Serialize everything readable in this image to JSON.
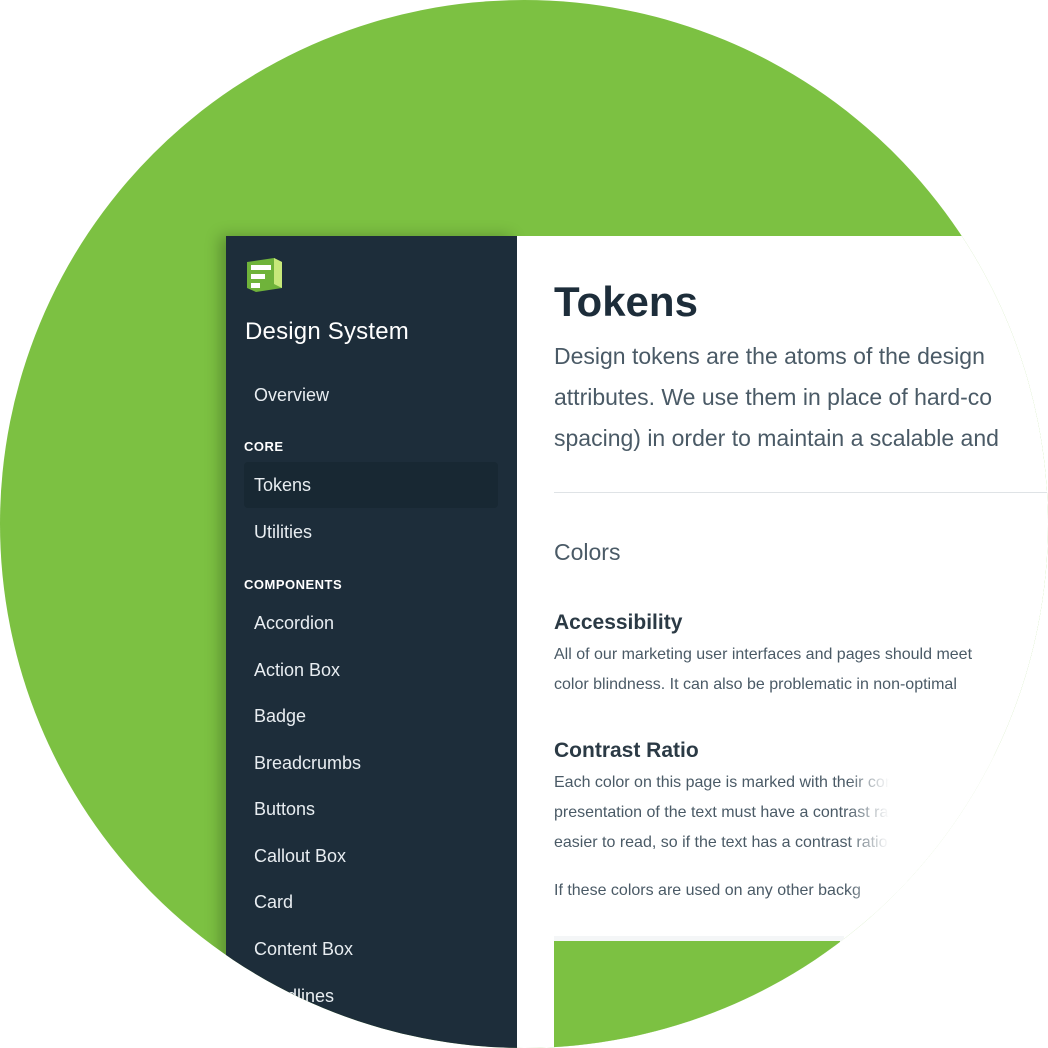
{
  "brand": {
    "name": "Design System"
  },
  "sidebar": {
    "items_top": [
      {
        "label": "Overview"
      }
    ],
    "sections": [
      {
        "label": "CORE",
        "items": [
          {
            "label": "Tokens",
            "active": true
          },
          {
            "label": "Utilities"
          }
        ]
      },
      {
        "label": "COMPONENTS",
        "items": [
          {
            "label": "Accordion"
          },
          {
            "label": "Action Box"
          },
          {
            "label": "Badge"
          },
          {
            "label": "Breadcrumbs"
          },
          {
            "label": "Buttons"
          },
          {
            "label": "Callout Box"
          },
          {
            "label": "Card"
          },
          {
            "label": "Content Box"
          },
          {
            "label": "Headlines"
          }
        ]
      }
    ]
  },
  "main": {
    "title": "Tokens",
    "intro_lines": [
      "Design tokens are the atoms of the design",
      "attributes. We use them in place of hard-co",
      "spacing) in order to maintain a scalable and"
    ],
    "colors_heading": "Colors",
    "accessibility": {
      "heading": "Accessibility",
      "lines": [
        "All of our marketing user interfaces and pages should meet",
        "color blindness. It can also be problematic in non-optimal"
      ]
    },
    "contrast": {
      "heading": "Contrast Ratio",
      "lines": [
        "Each color on this page is marked with their contrast",
        "presentation of the text must have a contrast ratio",
        "easier to read, so if the text has a contrast ratio c"
      ],
      "extra": "If these colors are used on any other backg"
    }
  },
  "colors": {
    "accent": "#7cc142",
    "sidebar_bg": "#1d2d3a",
    "sidebar_active": "#182833"
  }
}
